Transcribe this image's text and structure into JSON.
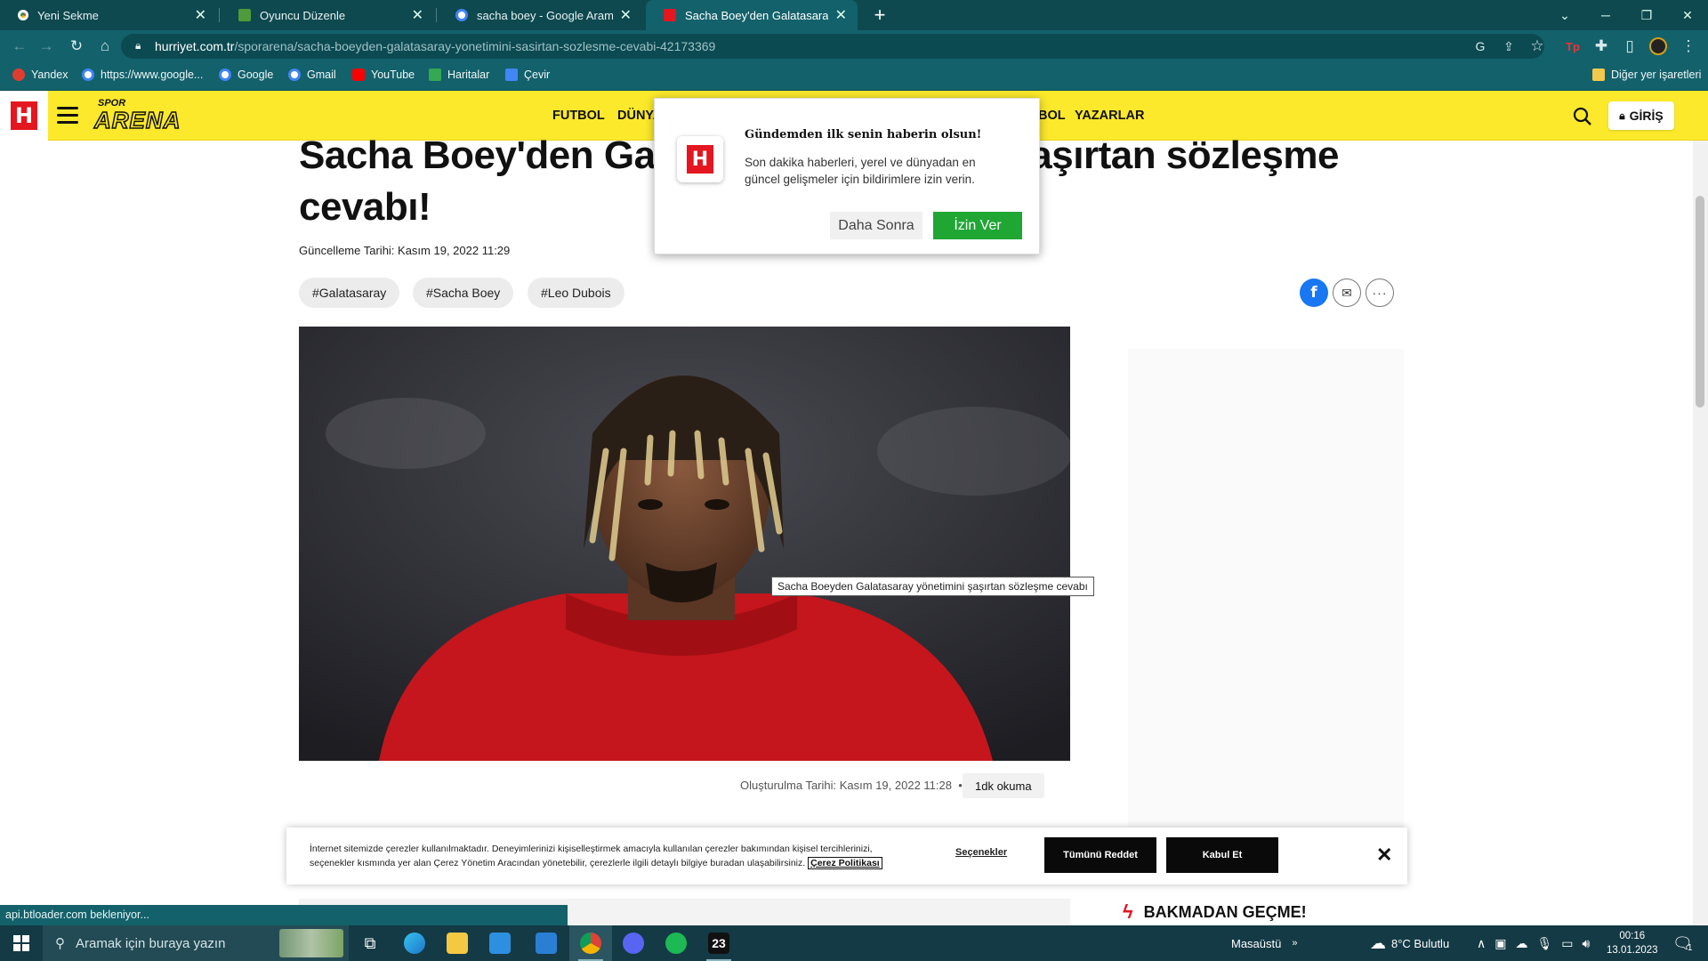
{
  "browser": {
    "tabs": [
      {
        "title": "Yeni Sekme",
        "favicon": "chrome-icon"
      },
      {
        "title": "Oyuncu Düzenle",
        "favicon": "game-icon"
      },
      {
        "title": "sacha boey - Google Arama",
        "favicon": "google-icon"
      },
      {
        "title": "Sacha Boey'den Galatasaray yöne",
        "favicon": "hurriyet-icon",
        "active": true
      }
    ],
    "url_domain": "hurriyet.com.tr",
    "url_path": "/sporarena/sacha-boeyden-galatasaray-yonetimini-sasirtan-sozlesme-cevabi-42173369",
    "bookmarks": [
      "Yandex",
      "https://www.google...",
      "Google",
      "Gmail",
      "YouTube",
      "Haritalar",
      "Çevir"
    ],
    "other_bookmarks": "Diğer yer işaretleri",
    "status_text": "api.btloader.com bekleniyor..."
  },
  "site": {
    "logo_letter": "H",
    "brand_top": "SPOR",
    "brand_bottom": "ARENA",
    "nav": [
      "FUTBOL",
      "DÜNYA",
      "BOL",
      "YAZARLAR"
    ],
    "login": "GİRİŞ",
    "colors": {
      "header_yellow": "#fce92b",
      "brand_red": "#e4161f"
    }
  },
  "article": {
    "title": "Sacha Boey'den Galatasaray yönetimini şaşırtan sözleşme cevabı!",
    "title_visible_part1": "Sacha Boey'den Gal",
    "title_visible_part2": "aşırtan sözleşme",
    "title_visible_line2": "cevabı!",
    "updated": "Güncelleme Tarihi: Kasım 19, 2022 11:29",
    "tags": [
      "#Galatasaray",
      "#Sacha Boey",
      "#Leo Dubois"
    ],
    "image_tooltip": "Sacha Boeyden Galatasaray yönetimini şaşırtan sözleşme cevabı",
    "created": "Oluşturulma Tarihi: Kasım 19, 2022 11:28",
    "separator": "•",
    "read_time": "1dk okuma",
    "sidebar_heading": "BAKMADAN GEÇME!"
  },
  "notification": {
    "title": "Gündemden ilk senin haberin olsun!",
    "text": "Son dakika haberleri, yerel ve dünyadan en güncel gelişmeler için bildirimlere izin verin.",
    "later": "Daha Sonra",
    "allow": "İzin Ver"
  },
  "cookie": {
    "text": "İnternet sitemizde çerezler kullanılmaktadır. Deneyimlerinizi kişiselleştirmek amacıyla kullanılan çerezler bakımından kişisel tercihlerinizi, seçenekler kısmında yer alan Çerez Yönetim Aracından yönetebilir, çerezlerle ilgili detaylı bilgiye buradan ulaşabilirsiniz.",
    "policy": "Çerez Politikası",
    "options": "Seçenekler",
    "reject": "Tümünü Reddet",
    "accept": "Kabul Et"
  },
  "taskbar": {
    "search_placeholder": "Aramak için buraya yazın",
    "desktop": "Masaüstü",
    "weather": "8°C  Bulutlu",
    "time": "00:16",
    "date": "13.01.2023",
    "badge": "23",
    "notif_count": "1"
  }
}
